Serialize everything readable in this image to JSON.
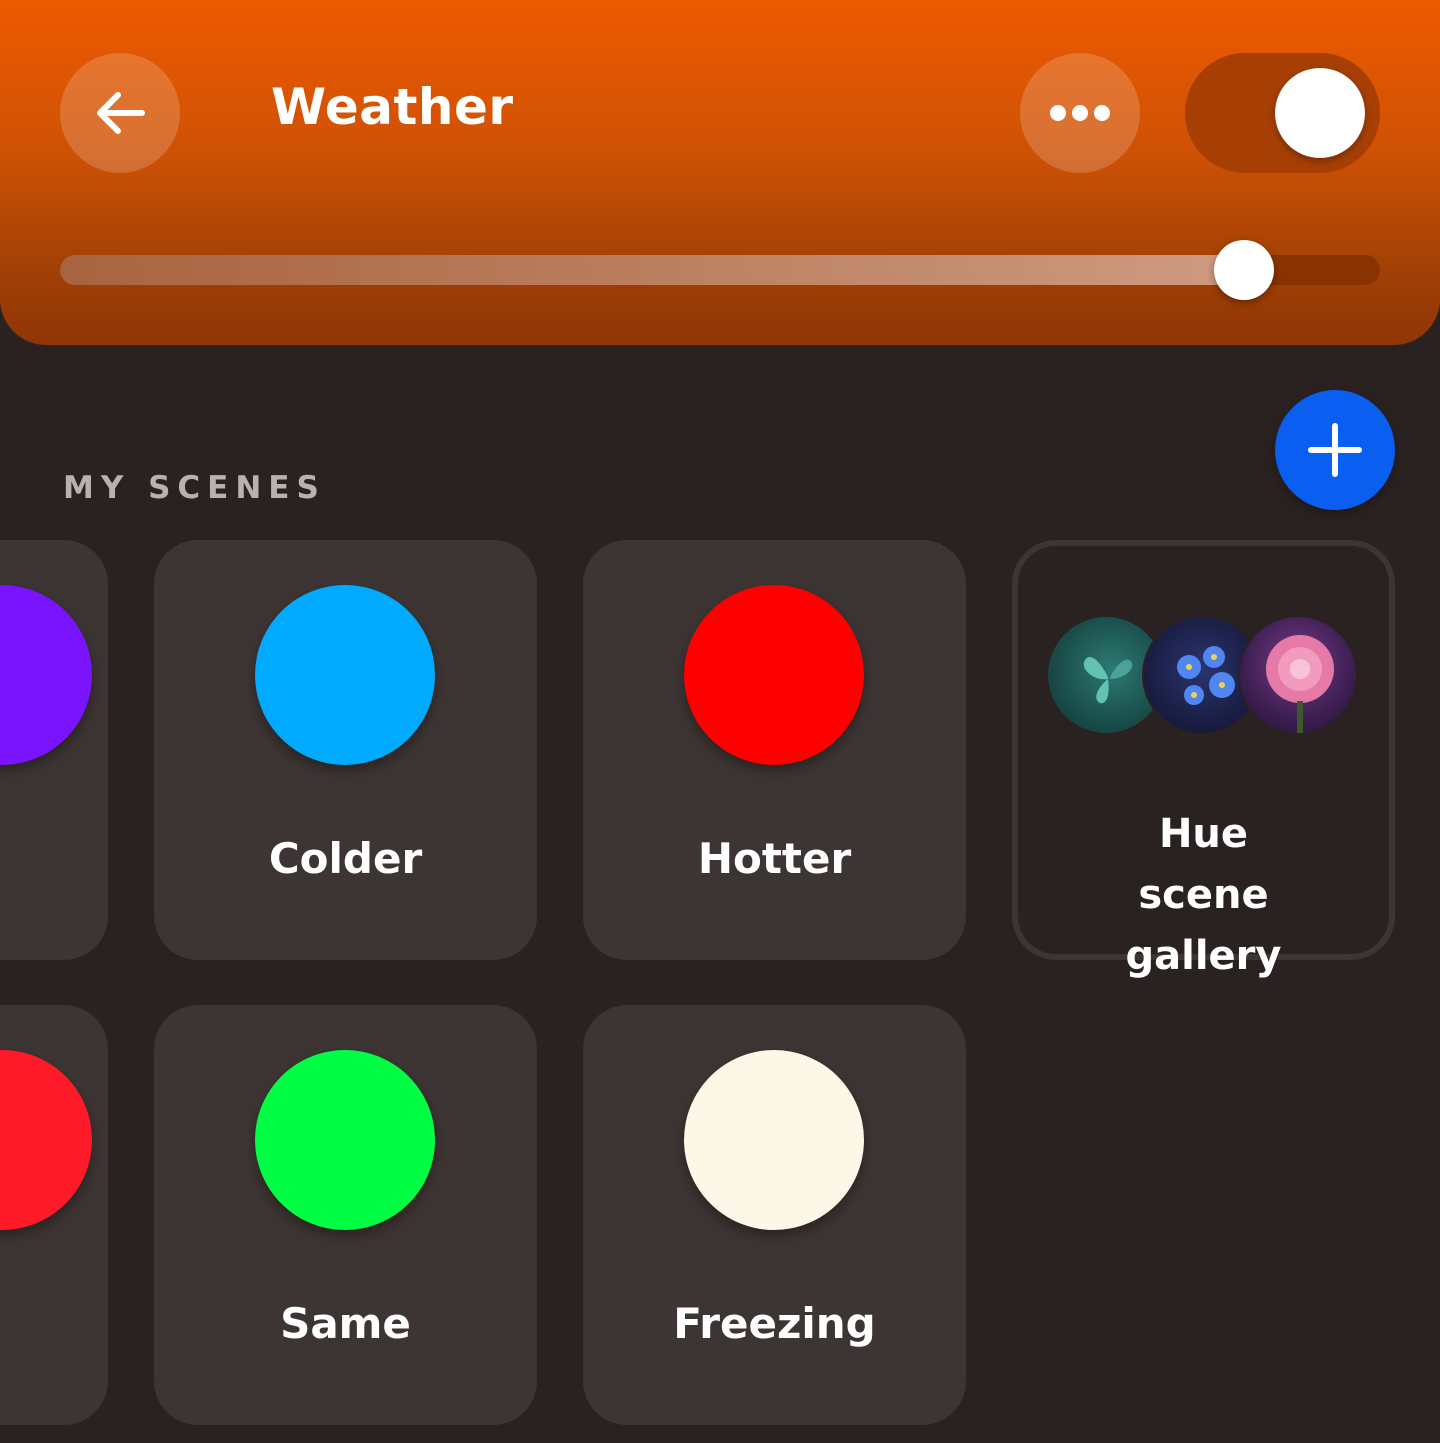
{
  "header": {
    "title": "Weather",
    "back_icon": "arrow-left-icon",
    "more_icon": "more-dots-icon",
    "power_on": true,
    "brightness_fraction": 0.897,
    "color": "#ee5a00"
  },
  "scenes": {
    "section_label": "MY SCENES",
    "add_icon": "plus-icon",
    "add_color": "#0a5ef0",
    "items": [
      {
        "label": "Colder",
        "color": "#00aaff"
      },
      {
        "label": "Hotter",
        "color": "#ff0000"
      },
      {
        "label": "Same",
        "color": "#00ff44"
      },
      {
        "label": "Freezing",
        "color": "#fdf7e7"
      }
    ],
    "partial_colors": [
      "#7a14ff",
      "#ff1a2a"
    ],
    "gallery": {
      "label": "Hue scene gallery",
      "thumbnails": [
        "butterfly-image",
        "blue-flowers-image",
        "dahlia-image"
      ]
    }
  }
}
